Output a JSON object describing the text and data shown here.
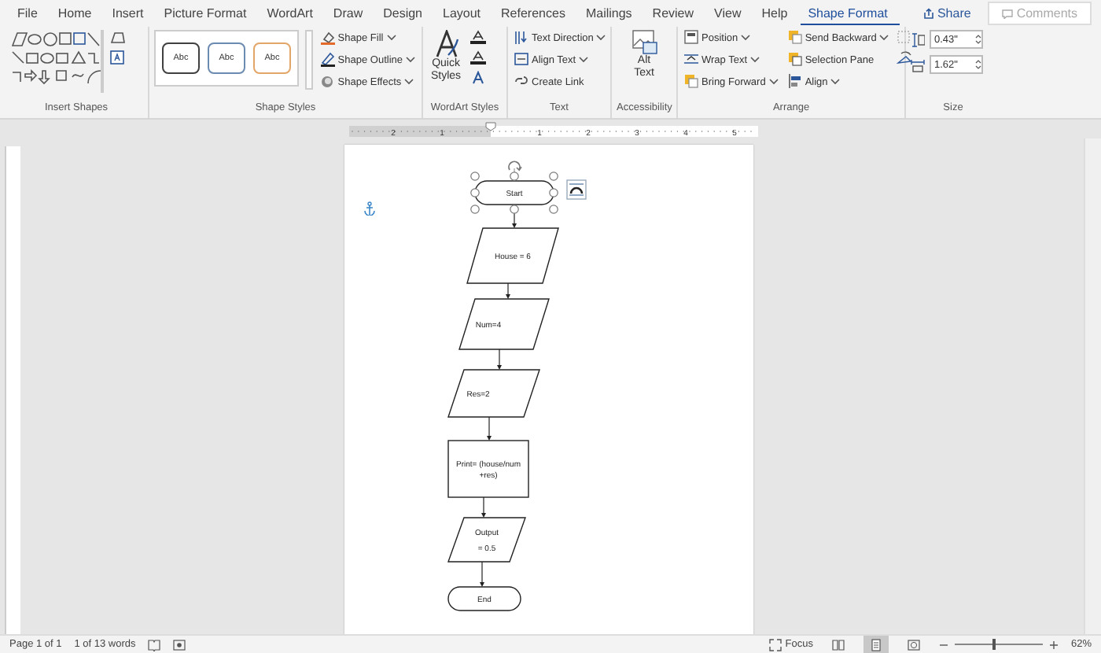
{
  "tabs": [
    {
      "label": "File",
      "selected": false
    },
    {
      "label": "Home",
      "selected": false
    },
    {
      "label": "Insert",
      "selected": false
    },
    {
      "label": "Picture Format",
      "selected": false
    },
    {
      "label": "WordArt",
      "selected": false
    },
    {
      "label": "Draw",
      "selected": false
    },
    {
      "label": "Design",
      "selected": false
    },
    {
      "label": "Layout",
      "selected": false
    },
    {
      "label": "References",
      "selected": false
    },
    {
      "label": "Mailings",
      "selected": false
    },
    {
      "label": "Review",
      "selected": false
    },
    {
      "label": "View",
      "selected": false
    },
    {
      "label": "Help",
      "selected": false
    },
    {
      "label": "Shape Format",
      "selected": true
    }
  ],
  "share_button": {
    "label": "Share"
  },
  "comments_button": {
    "label": "Comments",
    "disabled": true
  },
  "ribbon": {
    "groups": [
      {
        "kind": "shapes",
        "label": "Insert Shapes"
      },
      {
        "kind": "styles",
        "label": "Shape Styles",
        "styles": [
          {
            "label": "Abc",
            "color": "#404040"
          },
          {
            "label": "Abc",
            "color": "#6b8bb0"
          },
          {
            "label": "Abc",
            "color": "#e3a669"
          }
        ],
        "commands": [
          {
            "label": "Shape Fill",
            "dropdown": true
          },
          {
            "label": "Shape Outline",
            "dropdown": true
          },
          {
            "label": "Shape Effects",
            "dropdown": true
          }
        ]
      },
      {
        "kind": "wordart",
        "label": "WordArt Styles",
        "big": [
          "Quick",
          "Styles"
        ]
      },
      {
        "kind": "commands",
        "label": "Text",
        "commands": [
          {
            "label": "Text Direction",
            "dropdown": true
          },
          {
            "label": "Align Text",
            "dropdown": true
          },
          {
            "label": "Create Link",
            "dropdown": false
          }
        ]
      },
      {
        "kind": "big",
        "label": "Accessibility",
        "big": [
          "Alt",
          "Text"
        ]
      },
      {
        "kind": "arrange",
        "label": "Arrange",
        "commands": [
          {
            "label": "Position",
            "dropdown": true
          },
          {
            "label": "Wrap Text",
            "dropdown": true
          },
          {
            "label": "Bring Forward",
            "dropdown": true
          },
          {
            "label": "Send Backward",
            "dropdown": true
          },
          {
            "label": "Selection Pane",
            "dropdown": false
          },
          {
            "label": "Align",
            "dropdown": true
          }
        ]
      },
      {
        "kind": "size",
        "label": "Size",
        "height": "0.43\"",
        "width": "1.62\""
      }
    ]
  },
  "ruler": {
    "numbers": [
      "2",
      "1",
      "1",
      "2",
      "3",
      "4",
      "5"
    ]
  },
  "flowchart": {
    "nodes": [
      {
        "kind": "terminal",
        "lines": [
          "Start"
        ],
        "selected": true
      },
      {
        "kind": "data",
        "lines": [
          "House = 6"
        ],
        "selected": false
      },
      {
        "kind": "data",
        "lines": [
          "Num=4"
        ],
        "selected": false
      },
      {
        "kind": "data",
        "lines": [
          "Res=2"
        ],
        "selected": false
      },
      {
        "kind": "process",
        "lines": [
          "Print= (house/num",
          "+res)"
        ],
        "selected": false
      },
      {
        "kind": "data",
        "lines": [
          "Output",
          "= 0.5"
        ],
        "selected": false
      },
      {
        "kind": "terminal",
        "lines": [
          "End"
        ],
        "selected": false
      }
    ]
  },
  "status_bar": {
    "page": "Page 1 of 1",
    "words": "1 of 13 words",
    "focus": "Focus",
    "views": [
      {
        "kind": "read",
        "selected": false
      },
      {
        "kind": "print",
        "selected": true
      },
      {
        "kind": "web",
        "selected": false
      }
    ],
    "zoom": {
      "level": 0.45,
      "reading": "62%"
    }
  }
}
